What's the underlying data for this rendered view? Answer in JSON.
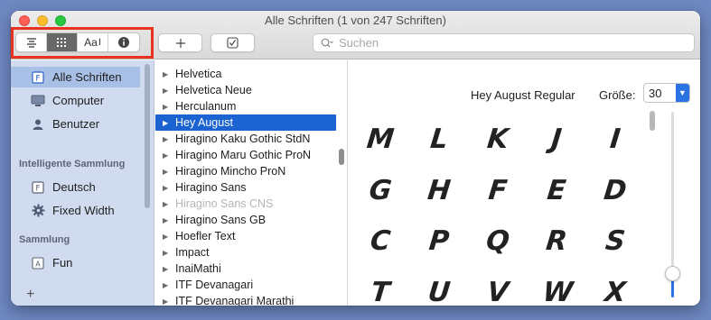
{
  "window": {
    "title": "Alle Schriften (1 von 247 Schriften)"
  },
  "toolbar": {
    "view_buttons": [
      {
        "icon": "list-view-icon"
      },
      {
        "icon": "grid-view-icon"
      },
      {
        "icon": "sample-text-icon",
        "label": "Aa"
      },
      {
        "icon": "info-icon"
      }
    ],
    "add_icon": "plus-icon",
    "check_icon": "checkbox-icon",
    "search_placeholder": "Suchen"
  },
  "sidebar": {
    "items": [
      {
        "label": "Alle Schriften",
        "icon": "font-book-icon",
        "selected": true
      },
      {
        "label": "Computer",
        "icon": "computer-icon"
      },
      {
        "label": "Benutzer",
        "icon": "user-icon"
      }
    ],
    "smart_heading": "Intelligente Sammlung",
    "smart_items": [
      {
        "label": "Deutsch",
        "icon": "font-book-icon"
      },
      {
        "label": "Fixed Width",
        "icon": "gear-icon"
      }
    ],
    "collection_heading": "Sammlung",
    "collection_items": [
      {
        "label": "Fun",
        "icon": "collection-icon"
      }
    ],
    "add_label": "+"
  },
  "fontlist": {
    "items": [
      {
        "label": "Helvetica"
      },
      {
        "label": "Helvetica Neue"
      },
      {
        "label": "Herculanum"
      },
      {
        "label": "Hey August",
        "selected": true
      },
      {
        "label": "Hiragino Kaku Gothic StdN"
      },
      {
        "label": "Hiragino Maru Gothic ProN"
      },
      {
        "label": "Hiragino Mincho ProN"
      },
      {
        "label": "Hiragino Sans"
      },
      {
        "label": "Hiragino Sans CNS",
        "dimmed": true
      },
      {
        "label": "Hiragino Sans GB"
      },
      {
        "label": "Hoefler Text"
      },
      {
        "label": "Impact"
      },
      {
        "label": "InaiMathi"
      },
      {
        "label": "ITF Devanagari"
      },
      {
        "label": "ITF Devanagari Marathi"
      }
    ]
  },
  "preview": {
    "font_name": "Hey August Regular",
    "size_label": "Größe:",
    "size_value": "30",
    "size_level": 0.15,
    "glyphs": [
      "M",
      "L",
      "K",
      "J",
      "I",
      "G",
      "H",
      "F",
      "E",
      "D",
      "C",
      "P",
      "Q",
      "R",
      "S",
      "T",
      "U",
      "V",
      "W",
      "X"
    ]
  },
  "colors": {
    "selection": "#1a63d1",
    "highlight_box": "#e8341f",
    "sidebar_bg": "#d1dbf0"
  }
}
